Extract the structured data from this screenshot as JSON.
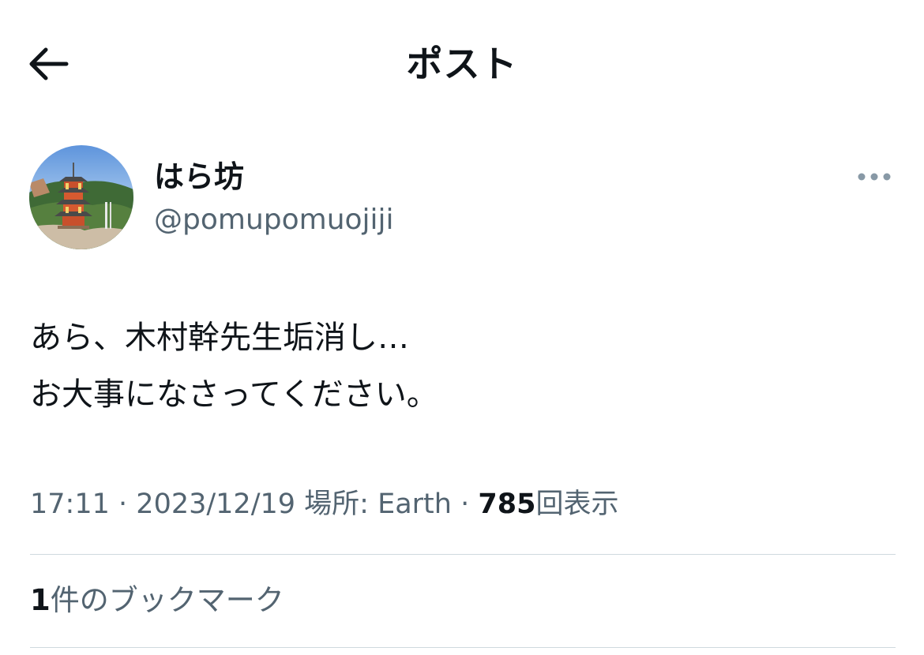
{
  "header": {
    "title": "ポスト"
  },
  "author": {
    "display_name": "はら坊",
    "handle": "@pomupomuojiji"
  },
  "post": {
    "lines": [
      "あら、木村幹先生垢消し…",
      "お大事になさってください。"
    ]
  },
  "meta": {
    "time": "17:11",
    "separator": "·",
    "date": "2023/12/19",
    "location": "場所: Earth",
    "views_count": "785",
    "views_label": "回表示"
  },
  "bookmarks": {
    "count": "1",
    "label": "件のブックマーク"
  },
  "colors": {
    "text": "#0f1419",
    "secondary": "#536471",
    "divider": "#cfd9de"
  },
  "icons": {
    "back": "arrow-left-icon",
    "more": "more-horizontal-icon"
  }
}
